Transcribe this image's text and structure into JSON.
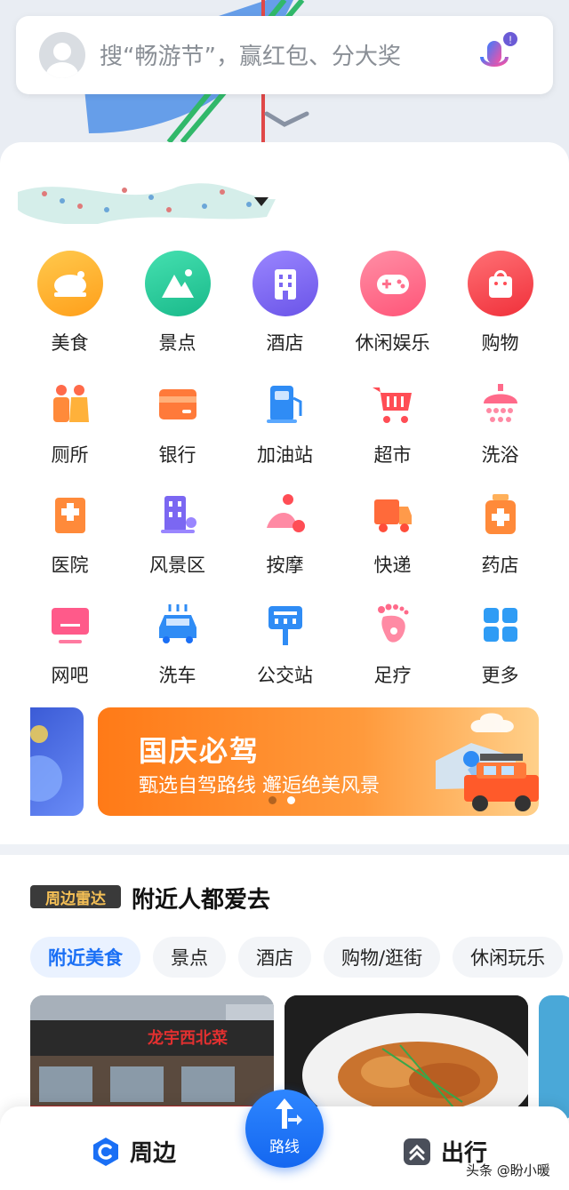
{
  "search": {
    "placeholder": "搜“畅游节”，赢红包、分大奖"
  },
  "categories_primary": [
    {
      "label": "美食",
      "icon": "food-icon",
      "color": "#ffb52e"
    },
    {
      "label": "景点",
      "icon": "scenic-icon",
      "color": "#2fcf9c"
    },
    {
      "label": "酒店",
      "icon": "hotel-icon",
      "color": "#7b67f2"
    },
    {
      "label": "休闲娱乐",
      "icon": "gamepad-icon",
      "color": "#ff6f8c"
    },
    {
      "label": "购物",
      "icon": "shopping-bag-icon",
      "color": "#ff4d55"
    }
  ],
  "categories_row2": [
    {
      "label": "厕所",
      "icon": "toilet-icon"
    },
    {
      "label": "银行",
      "icon": "bank-card-icon"
    },
    {
      "label": "加油站",
      "icon": "gas-station-icon"
    },
    {
      "label": "超市",
      "icon": "cart-icon"
    },
    {
      "label": "洗浴",
      "icon": "shower-icon"
    }
  ],
  "categories_row3": [
    {
      "label": "医院",
      "icon": "hospital-icon"
    },
    {
      "label": "风景区",
      "icon": "scenic-area-icon"
    },
    {
      "label": "按摩",
      "icon": "massage-icon"
    },
    {
      "label": "快递",
      "icon": "delivery-truck-icon"
    },
    {
      "label": "药店",
      "icon": "pharmacy-icon"
    }
  ],
  "categories_row4": [
    {
      "label": "网吧",
      "icon": "monitor-icon"
    },
    {
      "label": "洗车",
      "icon": "car-wash-icon"
    },
    {
      "label": "公交站",
      "icon": "bus-stop-icon"
    },
    {
      "label": "足疗",
      "icon": "foot-icon"
    },
    {
      "label": "更多",
      "icon": "grid-more-icon"
    }
  ],
  "banner": {
    "title": "国庆必驾",
    "subtitle": "甄选自驾路线 邂逅绝美风景"
  },
  "nearby": {
    "badge": "周边雷达",
    "title": "附近人都爱去",
    "chips": [
      "附近美食",
      "景点",
      "酒店",
      "购物/逛街",
      "休闲玩乐"
    ],
    "card1_sign": "龙宇西北菜"
  },
  "bottom_nav": {
    "left": "周边",
    "center": "路线",
    "right": "出行"
  },
  "watermark": "头条 @盼小暖",
  "colors": {
    "accent": "#1a6ff5",
    "banner": "#ff7a17"
  }
}
